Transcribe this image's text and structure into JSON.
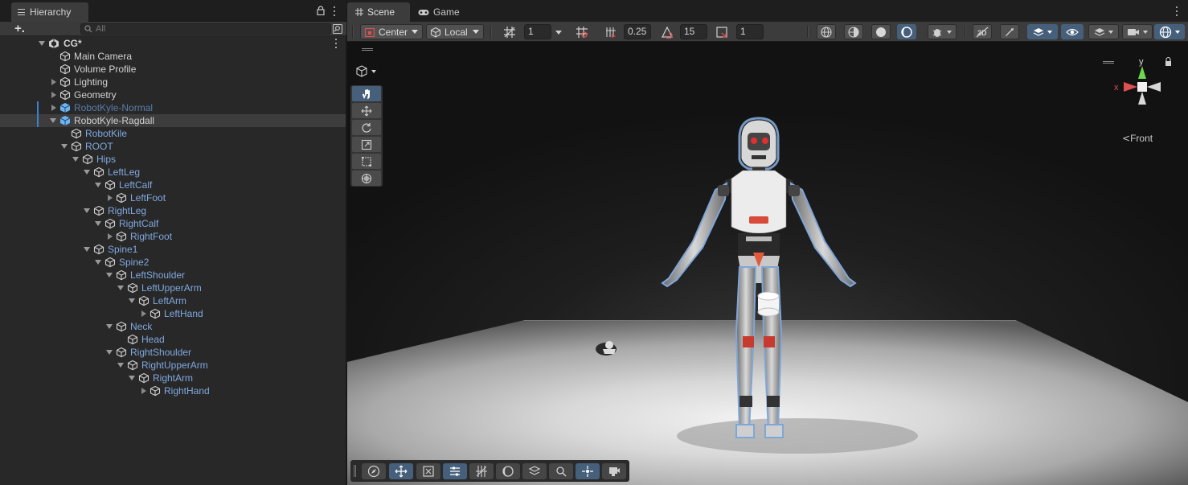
{
  "hierarchy": {
    "tab_title": "Hierarchy",
    "add_label": "+.",
    "search_placeholder": "All",
    "scene_name": "CG*",
    "items": [
      {
        "label": "Main Camera"
      },
      {
        "label": "Volume Profile"
      },
      {
        "label": "Lighting"
      },
      {
        "label": "Geometry"
      },
      {
        "label": "RobotKyle-Normal"
      },
      {
        "label": "RobotKyle-Ragdall"
      },
      {
        "label": "RobotKile"
      },
      {
        "label": "ROOT"
      },
      {
        "label": "Hips"
      },
      {
        "label": "LeftLeg"
      },
      {
        "label": "LeftCalf"
      },
      {
        "label": "LeftFoot"
      },
      {
        "label": "RightLeg"
      },
      {
        "label": "RightCalf"
      },
      {
        "label": "RightFoot"
      },
      {
        "label": "Spine1"
      },
      {
        "label": "Spine2"
      },
      {
        "label": "LeftShoulder"
      },
      {
        "label": "LeftUpperArm"
      },
      {
        "label": "LeftArm"
      },
      {
        "label": "LeftHand"
      },
      {
        "label": "Neck"
      },
      {
        "label": "Head"
      },
      {
        "label": "RightShoulder"
      },
      {
        "label": "RightUpperArm"
      },
      {
        "label": "RightArm"
      },
      {
        "label": "RightHand"
      }
    ]
  },
  "scene_view": {
    "tabs": [
      {
        "label": "Scene"
      },
      {
        "label": "Game"
      }
    ],
    "pivot_mode": "Center",
    "pivot_rotation": "Local",
    "grid_snap_value": "1",
    "move_snap_value": "0.25",
    "rotate_snap_value": "15",
    "scale_snap_value": "1",
    "orientation_label": "Front",
    "gizmo_axes": {
      "y": "y",
      "x": "x"
    }
  },
  "colors": {
    "accent": "#46607c",
    "prefab_blue": "#80a8e0",
    "panel": "#282828"
  }
}
